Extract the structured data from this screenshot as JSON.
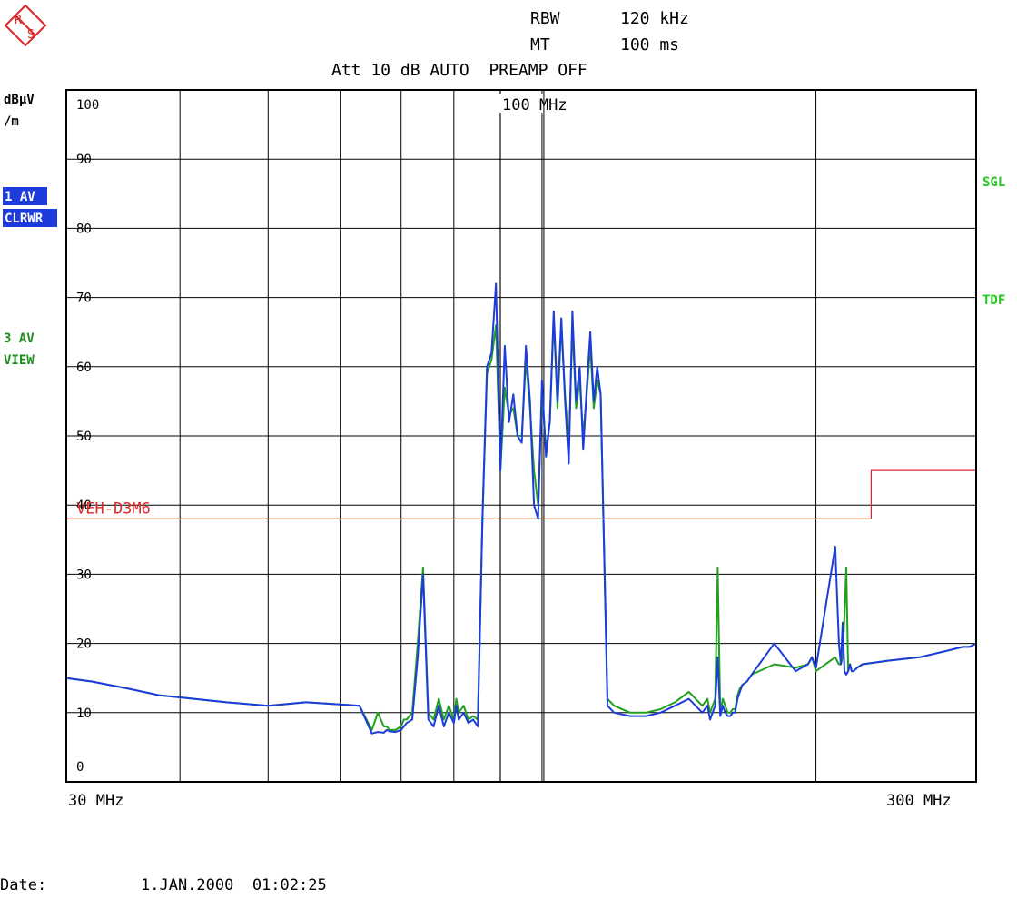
{
  "header": {
    "rbw_label": "RBW",
    "rbw_value": "120 kHz",
    "mt_label": "MT",
    "mt_value": "100 ms",
    "att_line": "Att 10 dB AUTO  PREAMP OFF"
  },
  "logo_letters": [
    "R",
    "S"
  ],
  "unit": {
    "line1": "dBµV",
    "line2": "/m"
  },
  "trace_labels": {
    "t1_line1": "1 AV",
    "t1_line2": "CLRWR",
    "t3_line1": "3 AV",
    "t3_line2": "VIEW"
  },
  "right_labels": {
    "sgl": "SGL",
    "tdf": "TDF"
  },
  "marker_label": "100 MHz",
  "x_axis": {
    "start": "30 MHz",
    "stop": "300 MHz"
  },
  "date_line": {
    "label": "Date:",
    "value": "1.JAN.2000  01:02:25"
  },
  "colors": {
    "blue_trace": "#1e3cdc",
    "green_trace": "#22a01e",
    "limit_line": "#dc2828",
    "label_blue_bg": "#1e3cdc",
    "label_green": "#1e8c1e"
  },
  "chart_data": {
    "type": "line",
    "xscale": "log",
    "xlim": [
      30,
      300
    ],
    "ylim": [
      0,
      100
    ],
    "yticks": [
      0,
      10,
      20,
      30,
      40,
      50,
      60,
      70,
      80,
      90,
      100
    ],
    "xgrid": [
      40,
      50,
      60,
      70,
      80,
      90,
      100,
      200
    ],
    "limit_line": {
      "name": "VEH-D3M6",
      "points": [
        [
          30,
          38
        ],
        [
          230,
          38
        ],
        [
          230,
          45
        ],
        [
          300,
          45
        ]
      ]
    },
    "series": [
      {
        "name": "1 AV",
        "x": [
          30,
          32,
          35,
          38,
          40,
          45,
          50,
          55,
          60,
          63,
          65,
          66,
          67,
          67.5,
          68,
          69,
          70,
          70.5,
          71,
          72,
          73,
          74,
          75,
          76,
          77,
          78,
          79,
          80,
          80.5,
          81,
          82,
          83,
          84,
          85,
          86,
          87,
          88,
          89,
          90,
          91,
          92,
          93,
          94,
          95,
          96,
          97,
          98,
          99,
          100,
          101,
          102,
          103,
          104,
          105,
          106,
          107,
          108,
          109,
          110,
          111,
          112,
          113,
          114,
          115,
          116,
          118,
          120,
          125,
          130,
          135,
          140,
          145,
          150,
          152,
          153,
          154,
          155,
          156,
          157,
          158,
          159,
          160,
          161,
          162,
          163,
          164,
          165,
          166,
          168,
          170,
          180,
          190,
          196,
          198,
          200,
          210,
          212,
          213,
          214,
          215,
          216,
          217,
          218,
          219,
          220,
          222,
          225,
          240,
          260,
          280,
          290,
          295,
          298,
          300
        ],
        "y": [
          15,
          14.5,
          13.5,
          12.5,
          12.2,
          11.5,
          11,
          11.5,
          11.2,
          11,
          7,
          7.2,
          7.1,
          7.5,
          7.3,
          7.2,
          7.5,
          8,
          8.5,
          9,
          18,
          30,
          9,
          8,
          11,
          8,
          10,
          8.5,
          11,
          9,
          10,
          8.5,
          9,
          8,
          38,
          60,
          62,
          72,
          45,
          63,
          52,
          56,
          50,
          49,
          63,
          55,
          40,
          38,
          58,
          47,
          52,
          68,
          55,
          67,
          55,
          46,
          68,
          55,
          60,
          48,
          57,
          65,
          55,
          60,
          56,
          11,
          10,
          9.5,
          9.5,
          10,
          11,
          12,
          10,
          11,
          9,
          10,
          11,
          18,
          9.5,
          11,
          10,
          9.5,
          9.5,
          10,
          10,
          12,
          13,
          14,
          14.5,
          15.5,
          20,
          16,
          17,
          18,
          16.5,
          34,
          20,
          17,
          23,
          16,
          15.5,
          16,
          17,
          16,
          16,
          16.5,
          17,
          17.5,
          18,
          19,
          19.5,
          19.5,
          19.8,
          20
        ]
      },
      {
        "name": "3 AV",
        "x": [
          30,
          32,
          35,
          38,
          40,
          45,
          50,
          55,
          60,
          63,
          65,
          66,
          67,
          67.5,
          68,
          69,
          70,
          70.5,
          71,
          72,
          73,
          74,
          75,
          76,
          77,
          78,
          79,
          80,
          80.5,
          81,
          82,
          83,
          84,
          85,
          86,
          87,
          88,
          89,
          90,
          91,
          92,
          93,
          94,
          95,
          96,
          97,
          98,
          99,
          100,
          101,
          102,
          103,
          104,
          105,
          106,
          107,
          108,
          109,
          110,
          111,
          112,
          113,
          114,
          115,
          116,
          118,
          120,
          125,
          130,
          135,
          140,
          145,
          150,
          152,
          153,
          154,
          155,
          156,
          157,
          158,
          159,
          160,
          161,
          162,
          163,
          164,
          165,
          166,
          168,
          170,
          180,
          190,
          196,
          198,
          200,
          210,
          212,
          213,
          214,
          215,
          216,
          217,
          218,
          219,
          220,
          222,
          225,
          240,
          260,
          280,
          290,
          295,
          298,
          300
        ],
        "y": [
          15,
          14.5,
          13.5,
          12.5,
          12.2,
          11.5,
          11,
          11.5,
          11.2,
          11,
          7.5,
          10,
          8,
          8,
          7.5,
          7.5,
          8,
          9,
          9,
          10,
          20,
          31,
          10,
          9,
          12,
          9,
          11,
          9,
          12,
          10,
          11,
          9,
          9.5,
          9,
          38,
          59,
          61,
          66,
          45,
          57,
          53,
          54,
          50,
          50,
          61,
          54,
          45,
          40,
          56,
          48,
          52,
          67,
          54,
          66,
          56,
          48,
          66,
          54,
          58,
          50,
          56,
          63,
          54,
          58,
          56,
          12,
          11,
          10,
          10,
          10.5,
          11.5,
          13,
          11,
          12,
          10,
          11,
          12,
          31,
          10,
          12,
          11,
          10,
          10,
          10.5,
          10.5,
          12.5,
          13.5,
          14,
          14.5,
          15.5,
          17,
          16.5,
          17,
          18,
          16,
          18,
          17,
          17,
          18,
          24,
          31,
          16,
          17,
          16,
          16,
          16.5,
          17,
          17.5,
          18,
          19,
          19.5,
          19.5,
          19.8,
          20
        ]
      }
    ]
  }
}
